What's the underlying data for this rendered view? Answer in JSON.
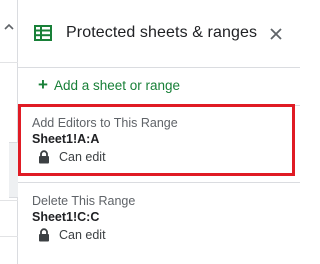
{
  "panel": {
    "title": "Protected sheets & ranges",
    "header_icon": "sheets-grid-icon",
    "close_icon": "close-icon"
  },
  "add_link": {
    "label": "Add a sheet or range"
  },
  "ranges": [
    {
      "description": "Add Editors to This Range",
      "range": "Sheet1!A:A",
      "permission": "Can edit",
      "highlighted": true
    },
    {
      "description": "Delete This Range",
      "range": "Sheet1!C:C",
      "permission": "Can edit",
      "highlighted": false
    }
  ],
  "colors": {
    "accent_green": "#188038",
    "highlight_red": "#e01b24"
  }
}
